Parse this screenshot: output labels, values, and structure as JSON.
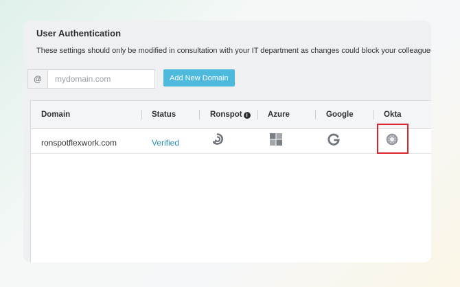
{
  "section": {
    "title": "User Authentication",
    "description": "These settings should only be modified in consultation with your IT department as changes could block your colleagues"
  },
  "domain_form": {
    "at_symbol": "@",
    "placeholder": "mydomain.com",
    "value": "",
    "add_button_label": "Add New Domain"
  },
  "table": {
    "columns": [
      "Domain",
      "Status",
      "Ronspot",
      "Azure",
      "Google",
      "Okta"
    ],
    "info_glyph": "i",
    "rows": [
      {
        "domain": "ronspotflexwork.com",
        "status": "Verified",
        "providers": {
          "ronspot": "ronspot-logo-icon",
          "azure": "azure-windows-icon",
          "google": "google-g-icon",
          "okta": "okta-sunburst-icon"
        }
      }
    ]
  },
  "colors": {
    "accent_button": "#4cb9dd",
    "status_verified": "#2a8db3",
    "highlight_box": "#d9262c"
  }
}
